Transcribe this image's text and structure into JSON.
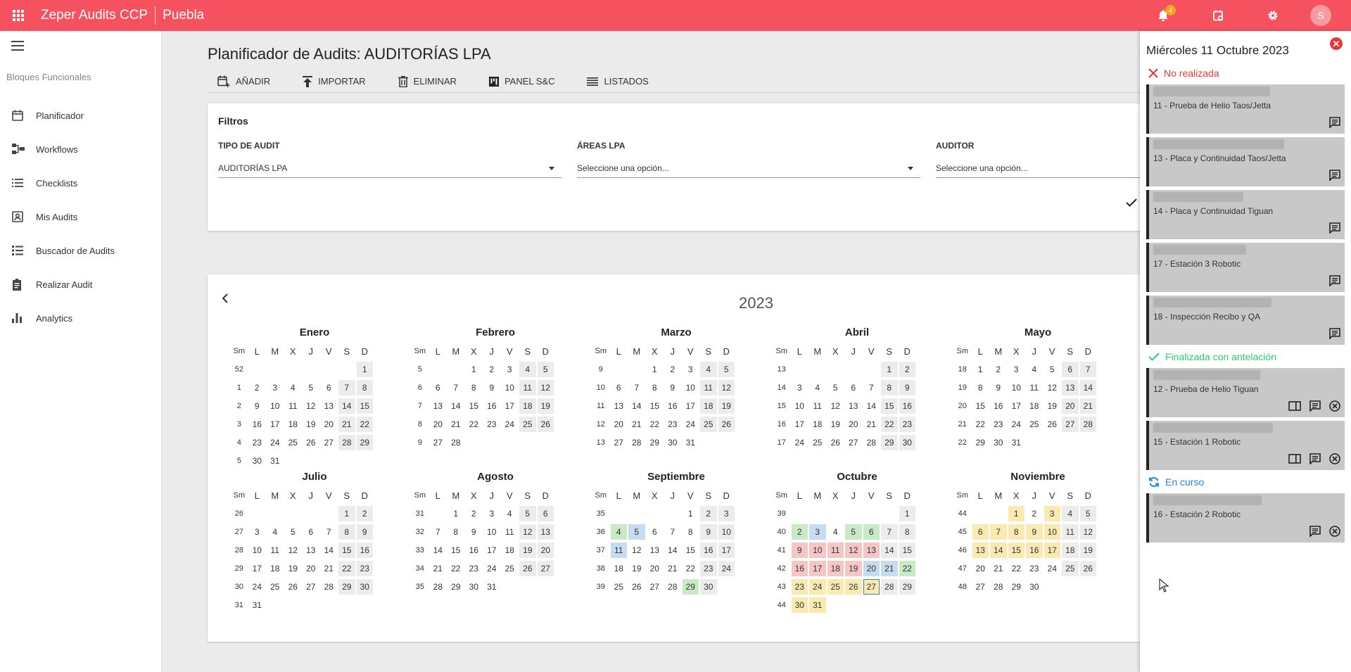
{
  "topbar": {
    "app_title": "Zeper Audits CCP",
    "site": "Puebla",
    "notification_count": "4",
    "avatar_initial": "S",
    "color": "#f5515f"
  },
  "sidebar": {
    "section_label": "Bloques Funcionales",
    "items": [
      {
        "label": "Planificador",
        "icon": "calendar-icon"
      },
      {
        "label": "Workflows",
        "icon": "workflow-icon"
      },
      {
        "label": "Checklists",
        "icon": "list-icon"
      },
      {
        "label": "Mis Audits",
        "icon": "contact-icon"
      },
      {
        "label": "Buscador de Audits",
        "icon": "list-search-icon"
      },
      {
        "label": "Realizar Audit",
        "icon": "clipboard-icon"
      },
      {
        "label": "Analytics",
        "icon": "bar-chart-icon"
      }
    ]
  },
  "main": {
    "title": "Planificador de Audits: AUDITORÍAS LPA",
    "toolbar": {
      "add": "AÑADIR",
      "import": "IMPORTAR",
      "delete": "ELIMINAR",
      "panel": "PANEL S&C",
      "lists": "LISTADOS"
    }
  },
  "filters": {
    "title": "Filtros",
    "audit_type": {
      "label": "TIPO DE AUDIT",
      "value": "AUDITORÍAS LPA"
    },
    "areas": {
      "label": "ÁREAS LPA",
      "value": "Seleccione una opción..."
    },
    "auditor": {
      "label": "AUDITOR",
      "value": "Seleccione una opción..."
    }
  },
  "calendar": {
    "year": "2023",
    "headers": [
      "Sm",
      "L",
      "M",
      "X",
      "J",
      "V",
      "S",
      "D"
    ],
    "today": "2023-10-27",
    "marks": {
      "2023-09-04": "g",
      "2023-09-05": "b",
      "2023-09-11": "b",
      "2023-09-29": "g",
      "2023-10-02": "g",
      "2023-10-03": "b",
      "2023-10-05": "g",
      "2023-10-06": "g",
      "2023-10-09": "r",
      "2023-10-10": "r",
      "2023-10-11": "r",
      "2023-10-12": "r",
      "2023-10-13": "r",
      "2023-10-16": "r",
      "2023-10-17": "r",
      "2023-10-18": "r",
      "2023-10-19": "r",
      "2023-10-20": "b",
      "2023-10-21": "b",
      "2023-10-22": "g",
      "2023-10-23": "y",
      "2023-10-24": "y",
      "2023-10-25": "y",
      "2023-10-26": "y",
      "2023-10-27": "y",
      "2023-10-30": "y",
      "2023-10-31": "y",
      "2023-11-01": "y",
      "2023-11-03": "y",
      "2023-11-06": "y",
      "2023-11-07": "y",
      "2023-11-08": "y",
      "2023-11-09": "y",
      "2023-11-10": "y",
      "2023-11-13": "y",
      "2023-11-14": "y",
      "2023-11-15": "y",
      "2023-11-16": "y",
      "2023-11-17": "y"
    },
    "month_colors": {
      "g": "#c8eac4",
      "b": "#c6dcf0",
      "r": "#f6c5c5",
      "y": "#fbe9b2"
    },
    "months": [
      {
        "name": "Enero",
        "index": 0
      },
      {
        "name": "Febrero",
        "index": 1
      },
      {
        "name": "Marzo",
        "index": 2
      },
      {
        "name": "Abril",
        "index": 3
      },
      {
        "name": "Mayo",
        "index": 4
      },
      {
        "name": "Julio",
        "index": 6
      },
      {
        "name": "Agosto",
        "index": 7
      },
      {
        "name": "Septiembre",
        "index": 8
      },
      {
        "name": "Octubre",
        "index": 9
      },
      {
        "name": "Noviembre",
        "index": 10
      }
    ]
  },
  "panel": {
    "date": "Miércoles 11 Octubre 2023",
    "groups": [
      {
        "status": "No realizada",
        "kind": "not-done",
        "color": "#e53935",
        "cards": [
          {
            "title": "11 - Prueba de Helio Taos/Jetta",
            "icons": [
              "comment-icon"
            ]
          },
          {
            "title": "13 - Placa y Continuidad Taos/Jetta",
            "icons": [
              "comment-icon"
            ]
          },
          {
            "title": "14 - Placa y Continuidad Tiguan",
            "icons": [
              "comment-icon"
            ]
          },
          {
            "title": "17 - Estación 3 Robotic",
            "icons": [
              "comment-icon"
            ]
          },
          {
            "title": "18 - Inspección Recibo y QA",
            "icons": [
              "comment-icon"
            ]
          }
        ]
      },
      {
        "status": "Finalizada con antelación",
        "kind": "done-early",
        "color": "#2ecc71",
        "cards": [
          {
            "title": "12 - Prueba de Helio Tiguan",
            "icons": [
              "view-icon",
              "comment-icon",
              "cancel-icon"
            ]
          },
          {
            "title": "15 - Estación 1 Robotic",
            "icons": [
              "view-icon",
              "comment-icon",
              "cancel-icon"
            ]
          }
        ]
      },
      {
        "status": "En curso",
        "kind": "in-progress",
        "color": "#1e88e5",
        "cards": [
          {
            "title": "16 - Estación 2 Robotic",
            "icons": [
              "comment-icon",
              "cancel-icon"
            ]
          }
        ]
      }
    ]
  }
}
